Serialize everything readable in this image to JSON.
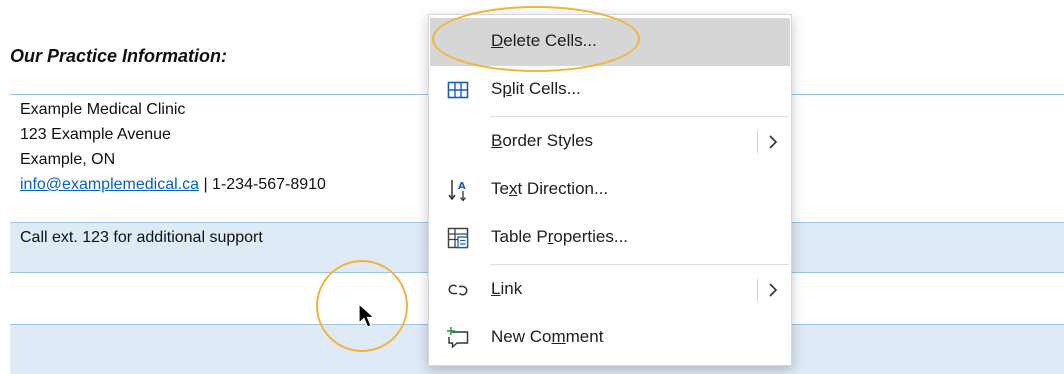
{
  "document": {
    "heading": "Our Practice Information:",
    "address_lines": [
      "Example Medical Clinic",
      "123 Example Avenue",
      "Example, ON"
    ],
    "email": "info@examplemedical.ca",
    "phone_sep": " | ",
    "phone": "1-234-567-8910",
    "support_note": "Call ext. 123 for additional support"
  },
  "context_menu": {
    "items": [
      {
        "pre": "",
        "key": "D",
        "post": "elete Cells...",
        "icon": "none",
        "hover": true
      },
      {
        "pre": "S",
        "key": "p",
        "post": "lit Cells...",
        "icon": "split-cells-icon"
      },
      {
        "pre": "",
        "key": "B",
        "post": "order Styles",
        "icon": "none",
        "submenu": true
      },
      {
        "pre": "Te",
        "key": "x",
        "post": "t Direction...",
        "icon": "text-direction-icon"
      },
      {
        "pre": "Table P",
        "key": "r",
        "post": "operties...",
        "icon": "table-properties-icon"
      },
      {
        "pre": "",
        "key": "L",
        "post": "ink",
        "icon": "link-icon",
        "submenu": true
      },
      {
        "pre": "New Co",
        "key": "m",
        "post": "ment",
        "icon": "new-comment-icon"
      }
    ]
  },
  "colors": {
    "annotation": "#f2b33d",
    "row_shade": "#deeaf6",
    "table_border": "#9dc3e6",
    "link": "#0563c1",
    "hover": "#d6d6d6"
  }
}
